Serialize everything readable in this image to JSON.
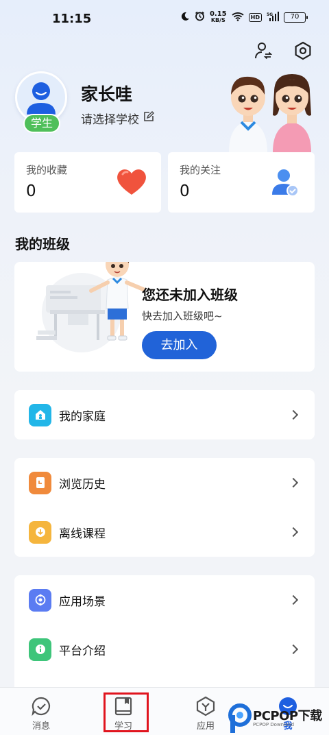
{
  "status_bar": {
    "time": "11:15",
    "net_speed_value": "0.15",
    "net_speed_unit": "KB/S",
    "hd": "HD",
    "battery": "70"
  },
  "profile": {
    "name": "家长哇",
    "role_badge": "学生",
    "school_placeholder": "请选择学校"
  },
  "stats": [
    {
      "label": "我的收藏",
      "value": "0",
      "icon": "heart-icon"
    },
    {
      "label": "我的关注",
      "value": "0",
      "icon": "user-follow-icon"
    }
  ],
  "my_class": {
    "section_title": "我的班级",
    "empty_title": "您还未加入班级",
    "empty_sub": "快去加入班级吧~",
    "join_button": "去加入"
  },
  "menu_groups": [
    [
      {
        "label": "我的家庭",
        "icon": "home-icon",
        "color": "#22b6e8"
      }
    ],
    [
      {
        "label": "浏览历史",
        "icon": "history-icon",
        "color": "#f08a3c"
      },
      {
        "label": "离线课程",
        "icon": "download-icon",
        "color": "#f5b53d"
      }
    ],
    [
      {
        "label": "应用场景",
        "icon": "scene-icon",
        "color": "#5b7cf2"
      },
      {
        "label": "平台介绍",
        "icon": "info-icon",
        "color": "#3ec57a"
      }
    ]
  ],
  "tab_bar": {
    "tabs": [
      {
        "label": "消息",
        "icon": "message-icon"
      },
      {
        "label": "学习",
        "icon": "book-icon"
      },
      {
        "label": "应用",
        "icon": "apps-icon"
      },
      {
        "label": "我",
        "icon": "me-icon",
        "active": true
      }
    ]
  },
  "watermark": {
    "brand": "PCPOP下载",
    "sub": "PCPOP Download"
  },
  "colors": {
    "accent": "#2163d8",
    "badge_green": "#4fbf5a",
    "highlight_red": "#e0141e"
  }
}
